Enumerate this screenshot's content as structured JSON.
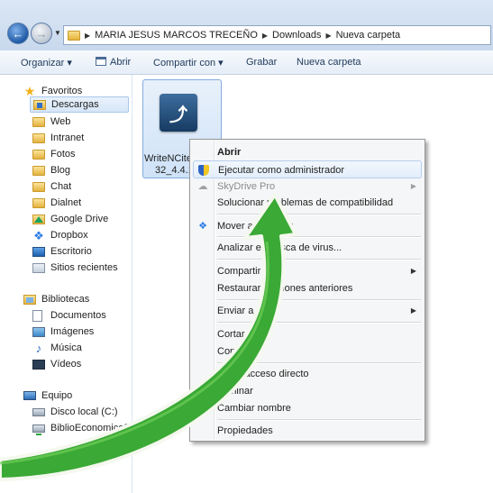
{
  "address": {
    "crumbs": [
      "MARIA JESUS MARCOS TRECEÑO",
      "Downloads",
      "Nueva carpeta"
    ]
  },
  "toolbar": {
    "organize": "Organizar ▾",
    "open": "Abrir",
    "share": "Compartir con ▾",
    "burn": "Grabar",
    "new_folder": "Nueva carpeta"
  },
  "sidebar": {
    "favorites_header": "Favoritos",
    "favorites": [
      "Descargas",
      "Web",
      "Intranet",
      "Fotos",
      "Blog",
      "Chat",
      "Dialnet",
      "Google Drive",
      "Dropbox",
      "Escritorio",
      "Sitios recientes"
    ],
    "libraries_header": "Bibliotecas",
    "libraries": [
      "Documentos",
      "Imágenes",
      "Música",
      "Vídeos"
    ],
    "computer_header": "Equipo",
    "computer": [
      "Disco local (C:)",
      "BiblioEconomica$ (\\"
    ]
  },
  "file": {
    "name_line1": "WriteNCite",
    "name_line2": "32_4.4.1"
  },
  "context_menu": {
    "items": [
      "Abrir",
      "Ejecutar como administrador",
      "SkyDrive Pro",
      "Solucionar problemas de compatibilidad",
      "Mover a Dropbox",
      "Analizar en busca de virus...",
      "Compartir con",
      "Restaurar versiones anteriores",
      "Enviar a",
      "Cortar",
      "Copiar",
      "Crear acceso directo",
      "Eliminar",
      "Cambiar nombre",
      "Propiedades"
    ],
    "occluded_labels": [
      "Soluc",
      "nas de compatibilidad",
      "Mo",
      "ox",
      "Analiza",
      "ca de virus...",
      "Comp",
      "Restau",
      "iones anteriores",
      "Envi",
      "Co",
      "r"
    ]
  },
  "colors": {
    "arrow_green": "#3aa935",
    "selection_blue": "#cfe2f7"
  }
}
